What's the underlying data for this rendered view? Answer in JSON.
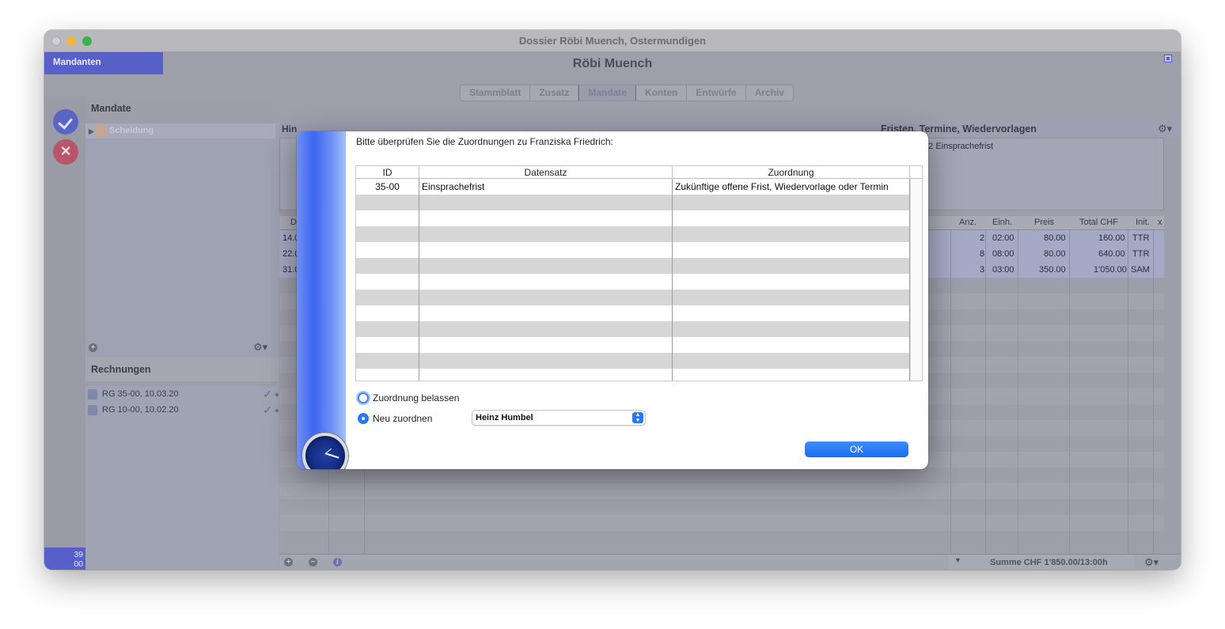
{
  "window": {
    "title": "Dossier Röbi Muench, Ostermundigen"
  },
  "header": {
    "mandanten_tab": "Mandanten",
    "client_name": "Röbi Muench"
  },
  "tabs": [
    {
      "label": "Stammblatt",
      "active": false
    },
    {
      "label": "Zusatz",
      "active": false
    },
    {
      "label": "Mandate",
      "active": true
    },
    {
      "label": "Konten",
      "active": false
    },
    {
      "label": "Entwürfe",
      "active": false
    },
    {
      "label": "Archiv",
      "active": false
    }
  ],
  "leftbar": {
    "counter_line1": "39",
    "counter_line2": "00"
  },
  "mandate": {
    "title": "Mandate",
    "items": [
      {
        "label": "Scheidung"
      }
    ]
  },
  "rechnungen": {
    "title": "Rechnungen",
    "items": [
      {
        "label": "RG 35-00, 10.03.20"
      },
      {
        "label": "RG 10-00, 10.02.20"
      }
    ]
  },
  "main": {
    "hinweise_label": "Hin",
    "fristen_label": "Fristen, Termine, Wiedervorlagen",
    "fristen_items": [
      ".22 Einsprachefrist"
    ],
    "columns": [
      "D",
      "Anz.",
      "Einh.",
      "Preis",
      "Total CHF",
      "Init.",
      "x"
    ],
    "rows": [
      {
        "date": "14.0",
        "anz": "2",
        "einh": "02:00",
        "preis": "80.00",
        "total": "160.00",
        "init": "TTR"
      },
      {
        "date": "22.0",
        "anz": "8",
        "einh": "08:00",
        "preis": "80.00",
        "total": "640.00",
        "init": "TTR"
      },
      {
        "date": "31.0",
        "anz": "3",
        "einh": "03:00",
        "preis": "350.00",
        "total": "1'050.00",
        "init": "SAM"
      }
    ],
    "summe": "Summe CHF 1'850.00/13:00h"
  },
  "dialog": {
    "message": "Bitte überprüfen Sie die Zuordnungen zu Franziska Friedrich:",
    "columns": {
      "id": "ID",
      "datensatz": "Datensatz",
      "zuordnung": "Zuordnung"
    },
    "rows": [
      {
        "id": "35-00",
        "datensatz": "Einsprachefrist",
        "zuordnung": "Zukünftige offene Frist, Wiedervorlage oder Termin"
      }
    ],
    "option_keep": "Zuordnung belassen",
    "option_reassign": "Neu zuordnen",
    "selected_option": "Neu zuordnen",
    "person_select": "Heinz Humbel",
    "ok_label": "OK"
  }
}
